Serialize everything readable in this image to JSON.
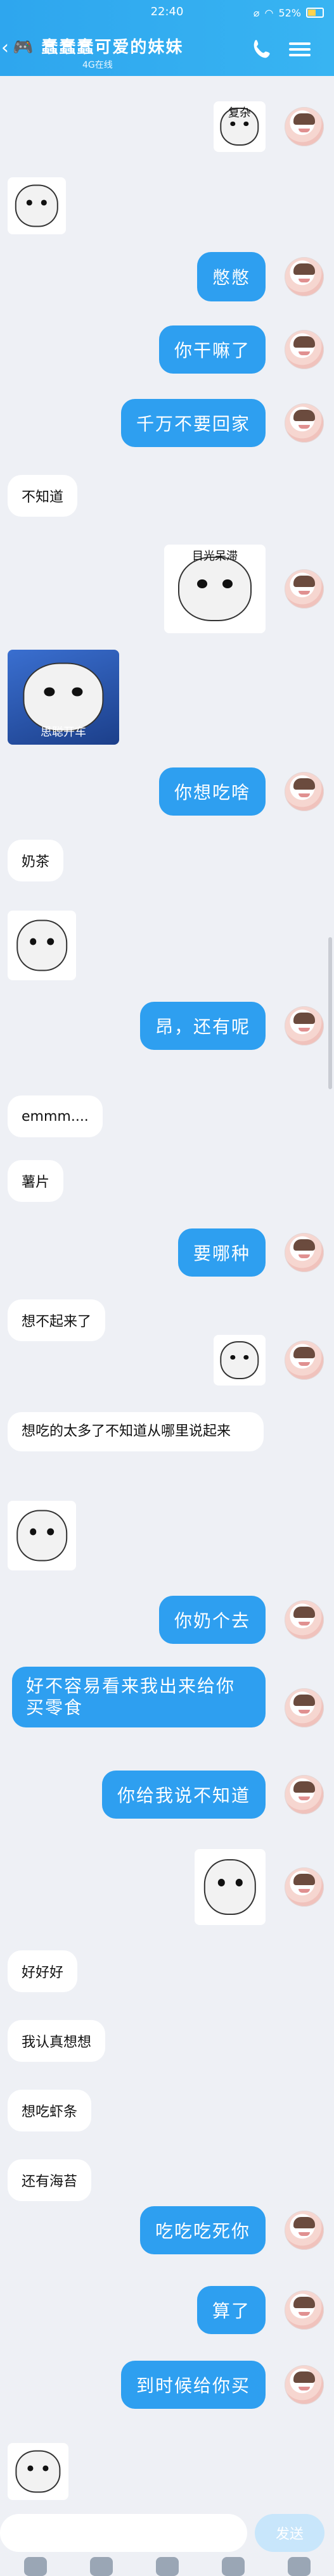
{
  "status_bar": {
    "time": "22:40",
    "battery": "52%"
  },
  "header": {
    "back": "‹",
    "title": "🎮 蠢蠢蠢可爱的妹妹",
    "subtitle": "4G在线",
    "phone_icon": "phone-icon",
    "menu_icon": "menu-icon"
  },
  "messages": [
    {
      "side": "out",
      "kind": "sticker",
      "caption": "复杂"
    },
    {
      "side": "in",
      "kind": "sticker",
      "caption": ""
    },
    {
      "side": "out",
      "kind": "text",
      "text": "憋憋"
    },
    {
      "side": "out",
      "kind": "text",
      "text": "你干嘛了"
    },
    {
      "side": "out",
      "kind": "text",
      "text": "千万不要回家"
    },
    {
      "side": "in",
      "kind": "text",
      "text": "不知道"
    },
    {
      "side": "out",
      "kind": "sticker",
      "caption": "目光呆滞"
    },
    {
      "side": "in",
      "kind": "sticker",
      "caption": "思聪开车"
    },
    {
      "side": "out",
      "kind": "text",
      "text": "你想吃啥"
    },
    {
      "side": "in",
      "kind": "text",
      "text": "奶茶"
    },
    {
      "side": "in",
      "kind": "sticker",
      "caption": ""
    },
    {
      "side": "out",
      "kind": "text",
      "text": "昂，还有呢"
    },
    {
      "side": "in",
      "kind": "text",
      "text": "emmm...."
    },
    {
      "side": "in",
      "kind": "text",
      "text": "薯片"
    },
    {
      "side": "out",
      "kind": "text",
      "text": "要哪种"
    },
    {
      "side": "in",
      "kind": "text",
      "text": "想不起来了"
    },
    {
      "side": "out",
      "kind": "sticker",
      "caption": ""
    },
    {
      "side": "in",
      "kind": "text",
      "text": "想吃的太多了不知道从哪里说起来"
    },
    {
      "side": "in",
      "kind": "sticker",
      "caption": ""
    },
    {
      "side": "out",
      "kind": "text",
      "text": "你奶个去"
    },
    {
      "side": "out",
      "kind": "text",
      "text": "好不容易看来我出来给你买零食"
    },
    {
      "side": "out",
      "kind": "text",
      "text": "你给我说不知道"
    },
    {
      "side": "out",
      "kind": "sticker",
      "caption": ""
    },
    {
      "side": "in",
      "kind": "text",
      "text": "好好好"
    },
    {
      "side": "in",
      "kind": "text",
      "text": "我认真想想"
    },
    {
      "side": "in",
      "kind": "text",
      "text": "想吃虾条"
    },
    {
      "side": "in",
      "kind": "text",
      "text": "还有海苔"
    },
    {
      "side": "out",
      "kind": "text",
      "text": "吃吃吃死你"
    },
    {
      "side": "out",
      "kind": "text",
      "text": "算了"
    },
    {
      "side": "out",
      "kind": "text",
      "text": "到时候给你买"
    },
    {
      "side": "in",
      "kind": "sticker",
      "caption": ""
    }
  ],
  "input": {
    "placeholder": "",
    "send_label": "发送"
  },
  "colors": {
    "accent": "#2e9ff0",
    "header": "#38b4f2"
  }
}
